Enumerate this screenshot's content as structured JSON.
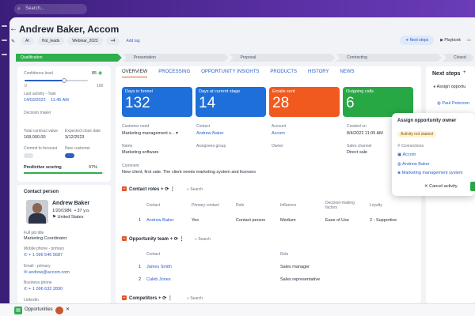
{
  "topbar": {
    "search_placeholder": "Search..."
  },
  "header": {
    "title": "Andrew Baker, Accom",
    "tags": [
      "AI",
      "Hot_leads",
      "Webinar_2023",
      "+4"
    ],
    "add_tag": "Add tag",
    "next_steps_btn": "Next steps",
    "playbook": "Playbook"
  },
  "pipeline": {
    "stages": [
      "Qualification",
      "Presentation",
      "Proposal",
      "Contracting",
      "Closed won"
    ],
    "active_index": 0
  },
  "left_panel": {
    "confidence_label": "Confidence level",
    "confidence_value": "85",
    "slider_min": "0",
    "slider_max": "100",
    "slider_fraction": 0.6,
    "last_activity_label": "Last activity - Task",
    "last_activity_value": "14/03/2022",
    "last_activity_time": "11:45 AM",
    "decision_maker_label": "Decision maker",
    "tcv_label": "Total contract value",
    "tcv_value": "168,000.00",
    "close_date_label": "Expected close date",
    "close_date_value": "3/12/2023",
    "commit_label": "Commit to forecast",
    "new_customer_label": "New customer",
    "predictive_label": "Predictive scoring",
    "predictive_value": "97%",
    "predictive_fraction": 0.97
  },
  "contact": {
    "section_title": "Contact person",
    "name": "Andrew Baker",
    "dob": "1/20/1986",
    "age": "• 37 y.o.",
    "country": "United States",
    "job_title_label": "Full job title",
    "job_title": "Marketing Coordinator",
    "mobile_label": "Mobile phone - primary",
    "mobile": "+ 1 096 546 5687",
    "email_label": "Email - primary",
    "email": "andrew@accom.com",
    "business_label": "Business phone",
    "business": "+ 1 096 632 2890",
    "linkedin_label": "LinkedIn"
  },
  "tabs": [
    "OVERVIEW",
    "PROCESSING",
    "OPPORTUNITY INSIGHTS",
    "PRODUCTS",
    "HISTORY",
    "NEWS"
  ],
  "kpis": [
    {
      "title": "Days in funnel",
      "value": "132",
      "color": "#1e6fd9"
    },
    {
      "title": "Days at current stage",
      "value": "14",
      "color": "#1e6fd9"
    },
    {
      "title": "Emails sent",
      "value": "28",
      "color": "#f05a1e"
    },
    {
      "title": "Outgoing calls",
      "value": "6",
      "color": "#27a844"
    }
  ],
  "fields": {
    "customer_need_label": "Customer need",
    "customer_need": "Marketing management s...",
    "contact_label": "Contact",
    "contact": "Andrew Baker",
    "account_label": "Account",
    "account": "Accom",
    "created_label": "Created on",
    "created": "8/4/2022 11:05 AM",
    "name_label": "Name",
    "name": "Marketing software",
    "assignees_label": "Assignees group",
    "owner_label": "Owner",
    "sales_channel_label": "Sales channel",
    "sales_channel": "Direct sale",
    "comment_label": "Comment",
    "comment": "New client, first sale. The client needs marketing system and licenses"
  },
  "contact_roles": {
    "title": "Contact roles",
    "search": "Search",
    "headers": [
      "Contact",
      "Primary contact",
      "Role",
      "Influence",
      "Decision-making factors",
      "Loyalty"
    ],
    "rows": [
      [
        "1",
        "Andrew Baker",
        "Yes",
        "Contact person",
        "Medium",
        "Ease of Use",
        "2 - Supportive"
      ]
    ]
  },
  "opportunity_team": {
    "title": "Opportunity team",
    "search": "Search",
    "headers": [
      "Contact",
      "Role"
    ],
    "rows": [
      [
        "1",
        "James Smith",
        "Sales manager"
      ],
      [
        "2",
        "Caleb Jones",
        "Sales representative"
      ]
    ]
  },
  "competitors": {
    "title": "Competitors",
    "search": "Search"
  },
  "next_steps_panel": {
    "title": "Next steps",
    "item1": "Assign opportu",
    "item2": "Paul Peterson"
  },
  "popup": {
    "title": "Assign opportunity owner",
    "status": "Activity not started",
    "connections_label": "Connections:",
    "c1": "Accom",
    "c2": "Andrew Baker",
    "c3": "Marketing management system",
    "cancel": "Cancel activity"
  },
  "bottombar": {
    "app_label": "Opportunities"
  },
  "colors": {
    "accent": "#2c5fc4",
    "stage_active": "#2fae4d",
    "section_icon": "#e2572a"
  }
}
